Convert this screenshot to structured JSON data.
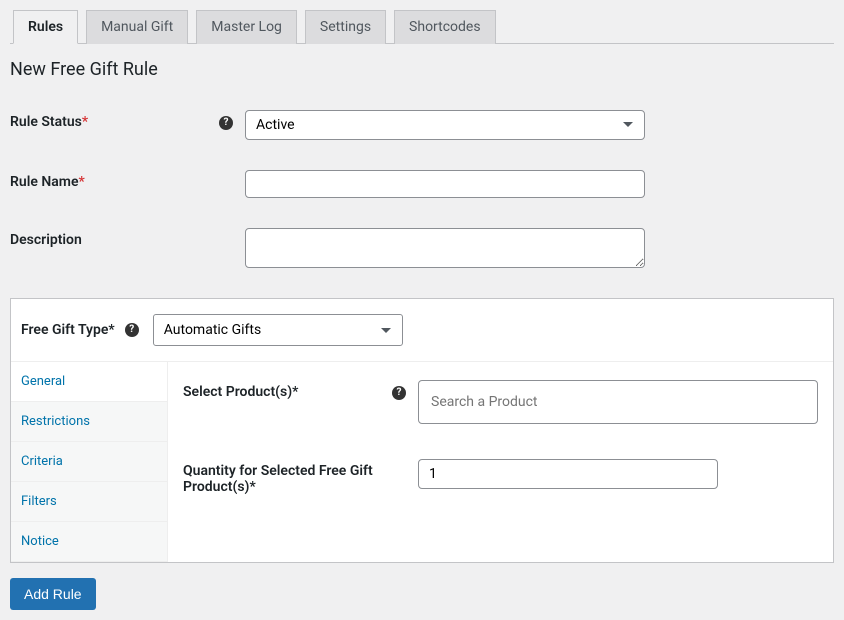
{
  "tabs": {
    "rules": "Rules",
    "manual_gift": "Manual Gift",
    "master_log": "Master Log",
    "settings": "Settings",
    "shortcodes": "Shortcodes"
  },
  "page_title": "New Free Gift Rule",
  "fields": {
    "rule_status_label": "Rule Status",
    "rule_status_value": "Active",
    "rule_name_label": "Rule Name",
    "rule_name_value": "",
    "description_label": "Description",
    "description_value": ""
  },
  "panel": {
    "type_label": "Free Gift Type",
    "type_value": "Automatic Gifts",
    "side": {
      "general": "General",
      "restrictions": "Restrictions",
      "criteria": "Criteria",
      "filters": "Filters",
      "notice": "Notice"
    },
    "select_products_label": "Select Product(s)",
    "search_placeholder": "Search a Product",
    "qty_label": "Quantity for Selected Free Gift Product(s)",
    "qty_value": "1"
  },
  "button": {
    "add_rule": "Add Rule"
  }
}
